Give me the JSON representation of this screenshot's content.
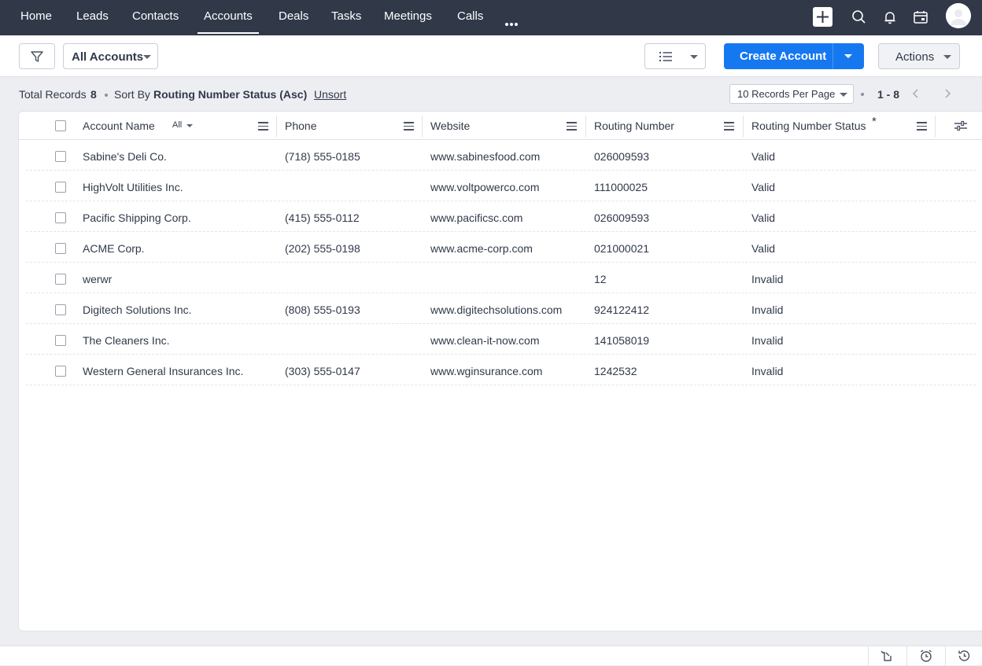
{
  "nav": {
    "items": [
      {
        "label": "Home"
      },
      {
        "label": "Leads"
      },
      {
        "label": "Contacts"
      },
      {
        "label": "Accounts",
        "active": true
      },
      {
        "label": "Deals"
      },
      {
        "label": "Tasks"
      },
      {
        "label": "Meetings"
      },
      {
        "label": "Calls"
      }
    ],
    "icons": [
      "more-icon",
      "plus-icon",
      "search-icon",
      "bell-icon",
      "calendar-icon",
      "avatar"
    ]
  },
  "toolbar": {
    "view_select": "All Accounts",
    "create_label": "Create Account",
    "actions_label": "Actions",
    "accent_color": "#1578f0"
  },
  "records": {
    "total_label": "Total Records",
    "total_count": "8",
    "sort_by_label": "Sort By",
    "sort_field": "Routing Number Status (Asc)",
    "unsort_label": "Unsort",
    "per_page": "10 Records Per Page",
    "range": "1 - 8"
  },
  "table": {
    "columns": {
      "account_name": "Account Name",
      "account_filter": "All",
      "phone": "Phone",
      "website": "Website",
      "routing_number": "Routing Number",
      "routing_status": "Routing Number Status",
      "status_required_mark": "*"
    },
    "rows": [
      {
        "name": "Sabine's Deli Co.",
        "phone": "(718) 555-0185",
        "website": "www.sabinesfood.com",
        "routing": "026009593",
        "status": "Valid"
      },
      {
        "name": "HighVolt Utilities Inc.",
        "phone": "",
        "website": "www.voltpowerco.com",
        "routing": "111000025",
        "status": "Valid"
      },
      {
        "name": "Pacific Shipping Corp.",
        "phone": "(415) 555-0112",
        "website": "www.pacificsc.com",
        "routing": "026009593",
        "status": "Valid"
      },
      {
        "name": "ACME Corp.",
        "phone": "(202) 555-0198",
        "website": "www.acme-corp.com",
        "routing": "021000021",
        "status": "Valid"
      },
      {
        "name": "werwr",
        "phone": "",
        "website": "",
        "routing": "12",
        "status": "Invalid"
      },
      {
        "name": "Digitech Solutions Inc.",
        "phone": "(808) 555-0193",
        "website": "www.digitechsolutions.com",
        "routing": "924122412",
        "status": "Invalid"
      },
      {
        "name": "The Cleaners Inc.",
        "phone": "",
        "website": "www.clean-it-now.com",
        "routing": "141058019",
        "status": "Invalid"
      },
      {
        "name": "Western General Insurances Inc.",
        "phone": "(303) 555-0147",
        "website": "www.wginsurance.com",
        "routing": "1242532",
        "status": "Invalid"
      }
    ]
  },
  "bottom_bar": {
    "icons": [
      "recent-items-icon",
      "reminder-alarm-icon",
      "history-icon"
    ]
  }
}
